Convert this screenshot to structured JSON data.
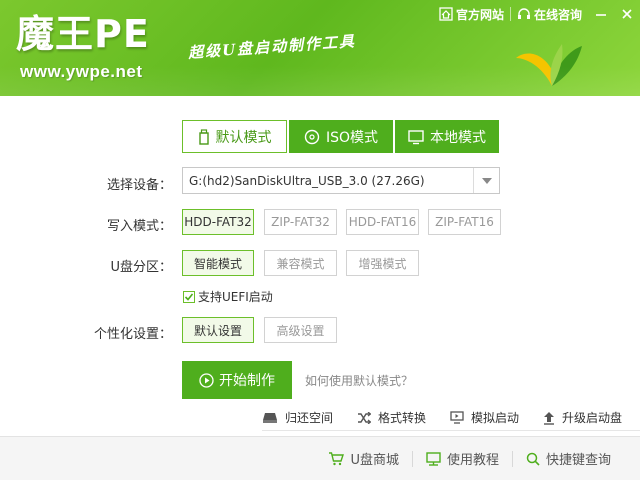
{
  "header": {
    "logo_title": "魔王PE",
    "logo_url": "www.ywpe.net",
    "slogan": "超级U盘启动制作工具",
    "links": {
      "official_site": "官方网站",
      "online_support": "在线咨询"
    }
  },
  "mode_tabs": [
    {
      "label": "默认模式",
      "icon": "usb-drive-icon",
      "active": true
    },
    {
      "label": "ISO模式",
      "icon": "disc-icon",
      "active": false
    },
    {
      "label": "本地模式",
      "icon": "monitor-icon",
      "active": false
    }
  ],
  "device": {
    "label": "选择设备：",
    "value": "G:(hd2)SanDiskUltra_USB_3.0 (27.26G)"
  },
  "write_mode": {
    "label": "写入模式：",
    "options": [
      "HDD-FAT32",
      "ZIP-FAT32",
      "HDD-FAT16",
      "ZIP-FAT16"
    ],
    "selected": "HDD-FAT32"
  },
  "partition": {
    "label": "U盘分区：",
    "options": [
      "智能模式",
      "兼容模式",
      "增强模式"
    ],
    "selected": "智能模式"
  },
  "uefi": {
    "label": "支持UEFI启动",
    "checked": true
  },
  "personalize": {
    "label": "个性化设置：",
    "options": [
      "默认设置",
      "高级设置"
    ],
    "selected": "默认设置"
  },
  "start": {
    "label": "开始制作",
    "help": "如何使用默认模式？"
  },
  "tools": [
    {
      "label": "归还空间",
      "icon": "disk-restore-icon"
    },
    {
      "label": "格式转换",
      "icon": "shuffle-icon"
    },
    {
      "label": "模拟启动",
      "icon": "simulate-screen-icon"
    },
    {
      "label": "升级启动盘",
      "icon": "upgrade-arrow-icon"
    }
  ],
  "footer": {
    "shop": "U盘商城",
    "tutorial": "使用教程",
    "shortcut": "快捷键查询"
  },
  "colors": {
    "brand_green": "#4fae1d",
    "header_green": "#6cc025",
    "border_green": "#6cbf2a"
  }
}
